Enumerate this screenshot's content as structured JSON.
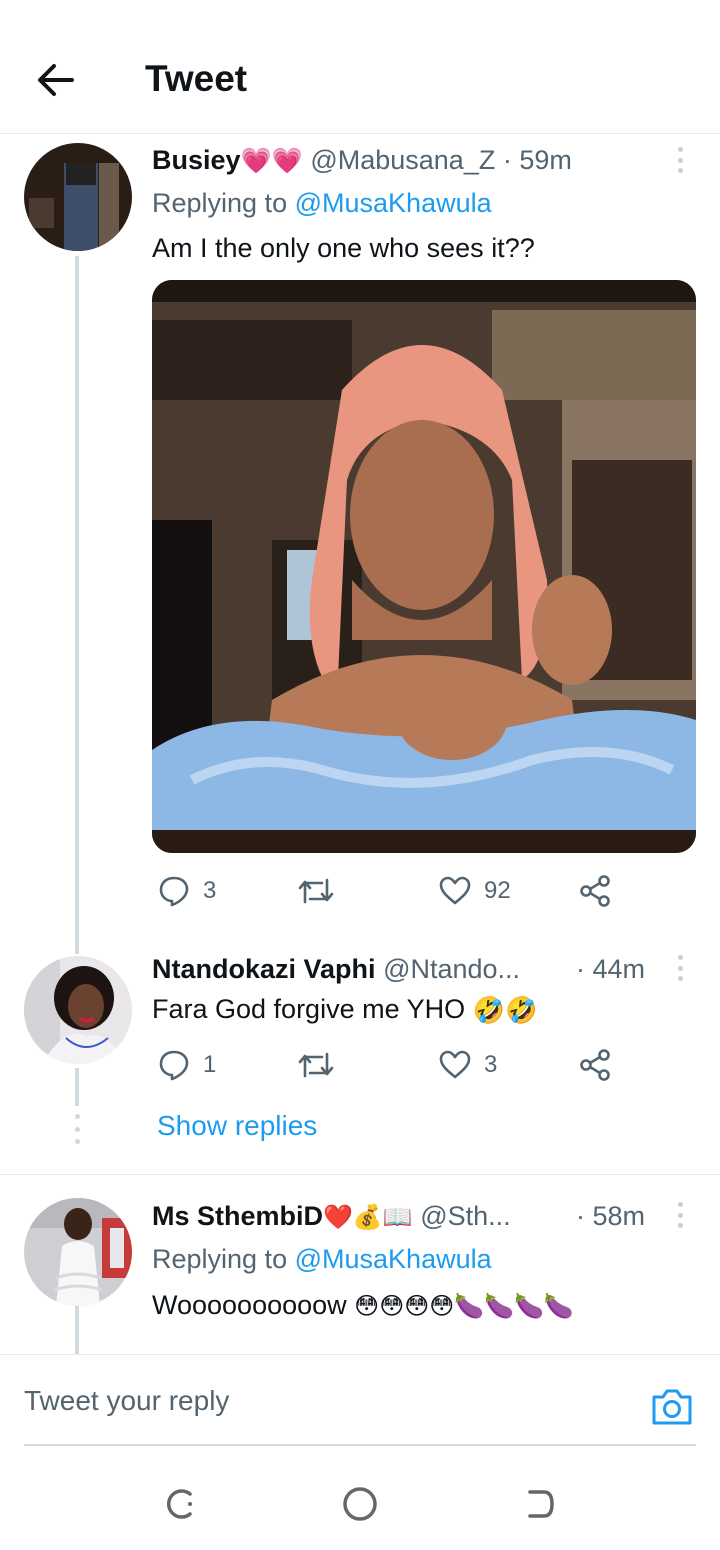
{
  "header": {
    "title": "Tweet"
  },
  "tweets": [
    {
      "display_name": "Busiey",
      "name_emojis": "💗💗",
      "handle": "@Mabusana_Z",
      "time": "· 59m",
      "replying_prefix": "Replying to",
      "replying_handle": "@MusaKhawula",
      "text": "Am I the only one who sees it??",
      "counts": {
        "replies": "3",
        "retweets": "",
        "likes": "92"
      }
    },
    {
      "display_name": "Ntandokazi Vaphi",
      "handle": "@Ntando...",
      "time": "· 44m",
      "text": "Fara God forgive me YHO",
      "text_emojis": "🤣🤣",
      "counts": {
        "replies": "1",
        "retweets": "",
        "likes": "3"
      }
    },
    {
      "display_name": "Ms SthembiD",
      "name_emojis": "❤️💰📖",
      "handle": "@Sth...",
      "time": "· 58m",
      "replying_prefix": "Replying to",
      "replying_handle": "@MusaKhawula",
      "text": "Woooooooooow",
      "text_emojis": "😳😳😳😳🍆🍆🍆🍆"
    }
  ],
  "show_replies_label": "Show replies",
  "reply_bar": {
    "placeholder": "Tweet your reply"
  },
  "icons": {
    "back": "arrow-left-icon",
    "more": "more-vertical-icon",
    "reply": "comment-icon",
    "retweet": "retweet-icon",
    "like": "heart-icon",
    "share": "share-icon",
    "camera": "camera-icon"
  },
  "colors": {
    "accent": "#1d9bf0",
    "text": "#0f1419",
    "muted": "#536471",
    "border": "#e6ecf0"
  }
}
